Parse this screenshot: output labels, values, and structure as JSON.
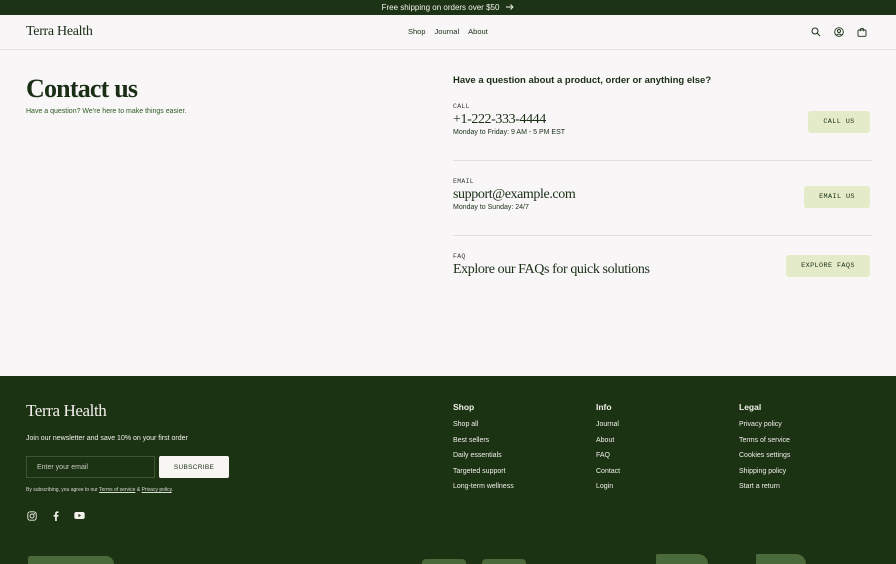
{
  "announcement": {
    "text": "Free shipping on orders over $50",
    "icon": "arrow-right-icon"
  },
  "header": {
    "brand": "Terra Health",
    "nav": [
      "Shop",
      "Journal",
      "About"
    ],
    "icons": [
      "search-icon",
      "account-icon",
      "cart-icon"
    ]
  },
  "hero": {
    "title": "Contact us",
    "subtitle": "Have a question? We're here to make things easier."
  },
  "contact": {
    "question": "Have a question about a product, order or anything else?",
    "call": {
      "label": "CALL",
      "value": "+1-222-333-4444",
      "note": "Monday to Friday: 9 AM - 5 PM EST",
      "button": "CALL US"
    },
    "email": {
      "label": "EMAIL",
      "value": "support@example.com",
      "note": "Monday to Sunday: 24/7",
      "button": "EMAIL US"
    },
    "faq": {
      "label": "FAQ",
      "value": "Explore our FAQs for quick solutions",
      "button": "EXPLORE FAQS"
    }
  },
  "footer": {
    "brand": "Terra Health",
    "newsletter": "Join our newsletter and save 10% on your first order",
    "email_placeholder": "Enter your email",
    "subscribe": "SUBSCRIBE",
    "legal_prefix": "By subscribing, you agree to our",
    "terms_link": "Terms of service",
    "amp": "&",
    "privacy_link": "Privacy policy",
    "legal_suffix": ".",
    "social": [
      "instagram-icon",
      "facebook-icon",
      "youtube-icon"
    ],
    "columns": {
      "shop": {
        "heading": "Shop",
        "links": [
          "Shop all",
          "Best sellers",
          "Daily essentials",
          "Targeted support",
          "Long-term wellness"
        ]
      },
      "info": {
        "heading": "Info",
        "links": [
          "Journal",
          "About",
          "FAQ",
          "Contact",
          "Login"
        ]
      },
      "legal": {
        "heading": "Legal",
        "links": [
          "Privacy policy",
          "Terms of service",
          "Cookies settings",
          "Shipping policy",
          "Start a return"
        ]
      }
    }
  },
  "colors": {
    "footer_bg": "#1b3213",
    "button_bg": "#e4ebc8",
    "page_bg": "#f8f6f7",
    "text": "#1a2e16"
  }
}
